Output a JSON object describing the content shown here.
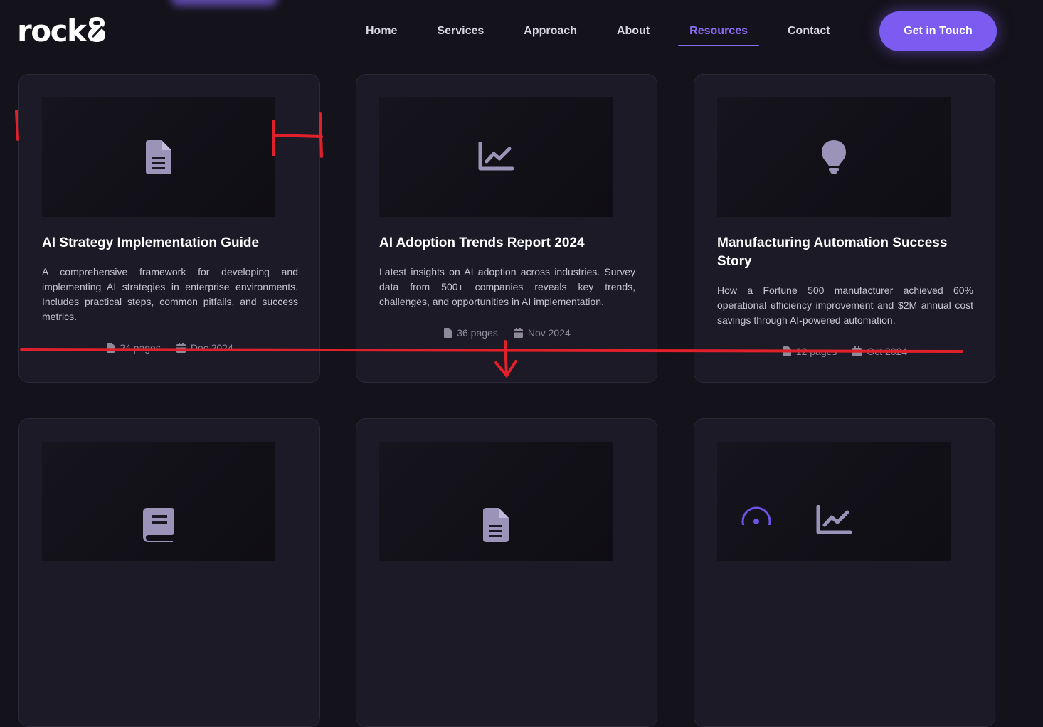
{
  "brand": {
    "name": "rock"
  },
  "nav": {
    "items": [
      {
        "label": "Home",
        "active": false
      },
      {
        "label": "Services",
        "active": false
      },
      {
        "label": "Approach",
        "active": false
      },
      {
        "label": "About",
        "active": false
      },
      {
        "label": "Resources",
        "active": true
      },
      {
        "label": "Contact",
        "active": false
      }
    ],
    "cta_label": "Get in Touch"
  },
  "colors": {
    "accent": "#7c5cf0",
    "background": "#14121a",
    "card": "#1d1a27",
    "annotation": "#e0202a"
  },
  "resources": [
    {
      "icon": "document-icon",
      "title": "AI Strategy Implementation Guide",
      "description": "A comprehensive framework for developing and implementing AI strategies in enterprise environments. Includes practical steps, common pitfalls, and success metrics.",
      "pages": "24 pages",
      "date": "Dec 2024"
    },
    {
      "icon": "chart-line-icon",
      "title": "AI Adoption Trends Report 2024",
      "description": "Latest insights on AI adoption across industries. Survey data from 500+ companies reveals key trends, challenges, and opportunities in AI implementation.",
      "pages": "36 pages",
      "date": "Nov 2024"
    },
    {
      "icon": "lightbulb-icon",
      "title": "Manufacturing Automation Success Story",
      "description": "How a Fortune 500 manufacturer achieved 60% operational efficiency improvement and $2M annual cost savings through AI-powered automation.",
      "pages": "12 pages",
      "date": "Oct 2024"
    },
    {
      "icon": "book-icon"
    },
    {
      "icon": "document-icon"
    },
    {
      "icon": "chart-line-icon"
    }
  ]
}
